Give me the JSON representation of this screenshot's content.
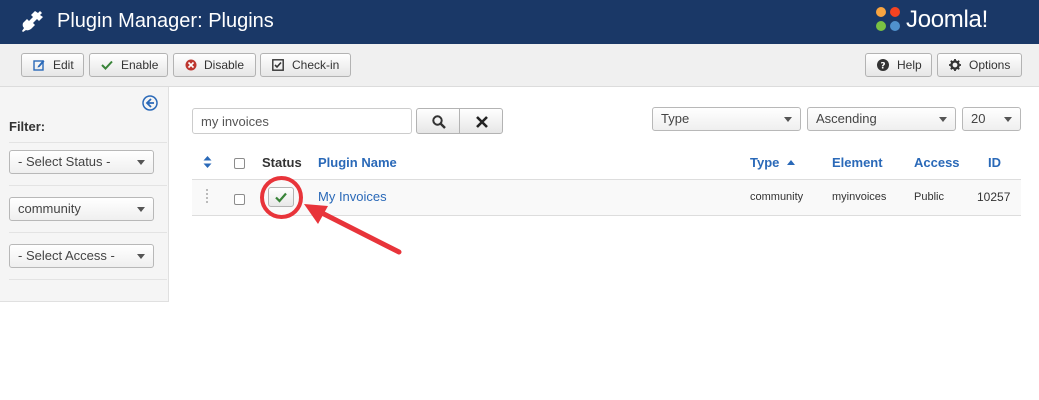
{
  "header": {
    "title": "Plugin Manager: Plugins",
    "logo_text": "Joomla!",
    "brand_color": "#1a3867"
  },
  "toolbar": {
    "edit": "Edit",
    "enable": "Enable",
    "disable": "Disable",
    "checkin": "Check-in",
    "help": "Help",
    "options": "Options"
  },
  "sidebar": {
    "filter_label": "Filter:",
    "status_select": "- Select Status -",
    "type_select": "community",
    "access_select": "- Select Access -"
  },
  "search": {
    "value": "my invoices"
  },
  "list_controls": {
    "order_by": "Type",
    "direction": "Ascending",
    "limit": "20"
  },
  "table": {
    "headers": {
      "status": "Status",
      "name": "Plugin Name",
      "type": "Type",
      "element": "Element",
      "access": "Access",
      "id": "ID"
    },
    "rows": [
      {
        "name": "My Invoices",
        "type": "community",
        "element": "myinvoices",
        "access": "Public",
        "id": "10257",
        "enabled": true
      }
    ]
  },
  "annotation_color": "#e8343a"
}
